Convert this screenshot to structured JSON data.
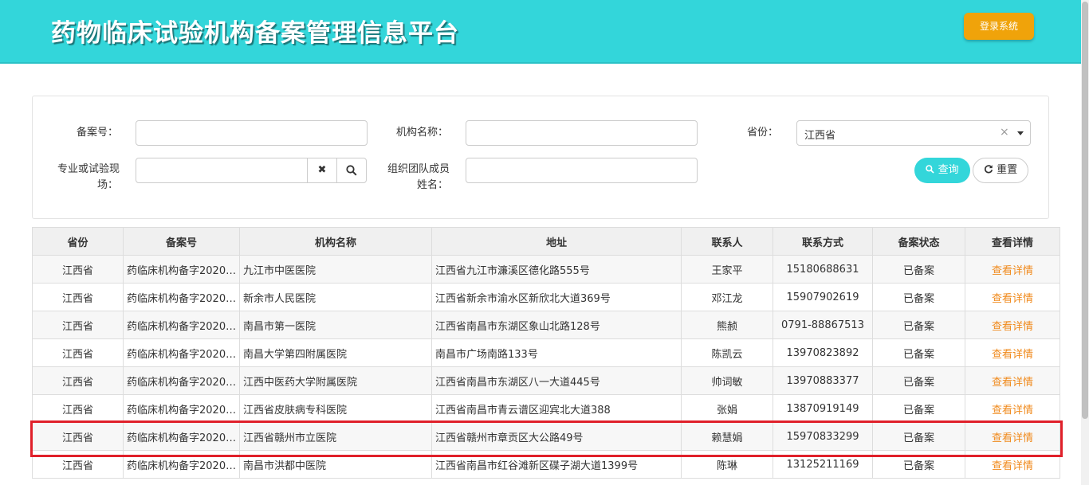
{
  "header": {
    "title": "药物临床试验机构备案管理信息平台",
    "login_label": "登录系统"
  },
  "search": {
    "record_no_label": "备案号：",
    "org_name_label": "机构名称：",
    "province_label": "省份：",
    "province_value": "江西省",
    "specialty_label_line1": "专业或试验现",
    "specialty_label_line2": "场：",
    "member_label_line1": "组织团队成员",
    "member_label_line2": "姓名：",
    "clear_glyph": "✖",
    "query_label": "查询",
    "reset_label": "重置"
  },
  "table": {
    "columns": [
      "省份",
      "备案号",
      "机构名称",
      "地址",
      "联系人",
      "联系方式",
      "备案状态",
      "查看详情"
    ],
    "rows": [
      {
        "province": "江西省",
        "record_no": "药临床机构备字20200...",
        "org": "九江市中医医院",
        "address": "江西省九江市濂溪区德化路555号",
        "contact": "王家平",
        "phone": "15180688631",
        "status": "已备案",
        "detail": "查看详情"
      },
      {
        "province": "江西省",
        "record_no": "药临床机构备字20200...",
        "org": "新余市人民医院",
        "address": "江西省新余市渝水区新欣北大道369号",
        "contact": "邓江龙",
        "phone": "15907902619",
        "status": "已备案",
        "detail": "查看详情"
      },
      {
        "province": "江西省",
        "record_no": "药临床机构备字20200...",
        "org": "南昌市第一医院",
        "address": "江西省南昌市东湖区象山北路128号",
        "contact": "熊赪",
        "phone": "0791-88867513",
        "status": "已备案",
        "detail": "查看详情"
      },
      {
        "province": "江西省",
        "record_no": "药临床机构备字20200...",
        "org": "南昌大学第四附属医院",
        "address": "南昌市广场南路133号",
        "contact": "陈凯云",
        "phone": "13970823892",
        "status": "已备案",
        "detail": "查看详情"
      },
      {
        "province": "江西省",
        "record_no": "药临床机构备字20200...",
        "org": "江西中医药大学附属医院",
        "address": "江西省南昌市东湖区八一大道445号",
        "contact": "帅词敏",
        "phone": "13970883377",
        "status": "已备案",
        "detail": "查看详情"
      },
      {
        "province": "江西省",
        "record_no": "药临床机构备字20200...",
        "org": "江西省皮肤病专科医院",
        "address": "江西省南昌市青云谱区迎宾北大道388",
        "contact": "张娟",
        "phone": "13870919149",
        "status": "已备案",
        "detail": "查看详情"
      },
      {
        "province": "江西省",
        "record_no": "药临床机构备字20200...",
        "org": "江西省赣州市立医院",
        "address": "江西省赣州市章贡区大公路49号",
        "contact": "赖慧娟",
        "phone": "15970833299",
        "status": "已备案",
        "detail": "查看详情"
      },
      {
        "province": "江西省",
        "record_no": "药临床机构备字20200...",
        "org": "南昌市洪都中医院",
        "address": "江西省南昌市红谷滩新区碟子湖大道1399号",
        "contact": "陈琳",
        "phone": "13125211169",
        "status": "已备案",
        "detail": "查看详情"
      }
    ]
  },
  "colors": {
    "header_bg": "#33d6da",
    "login_bg": "#f0a30a",
    "link": "#f08a1c",
    "highlight": "#e0202a"
  }
}
